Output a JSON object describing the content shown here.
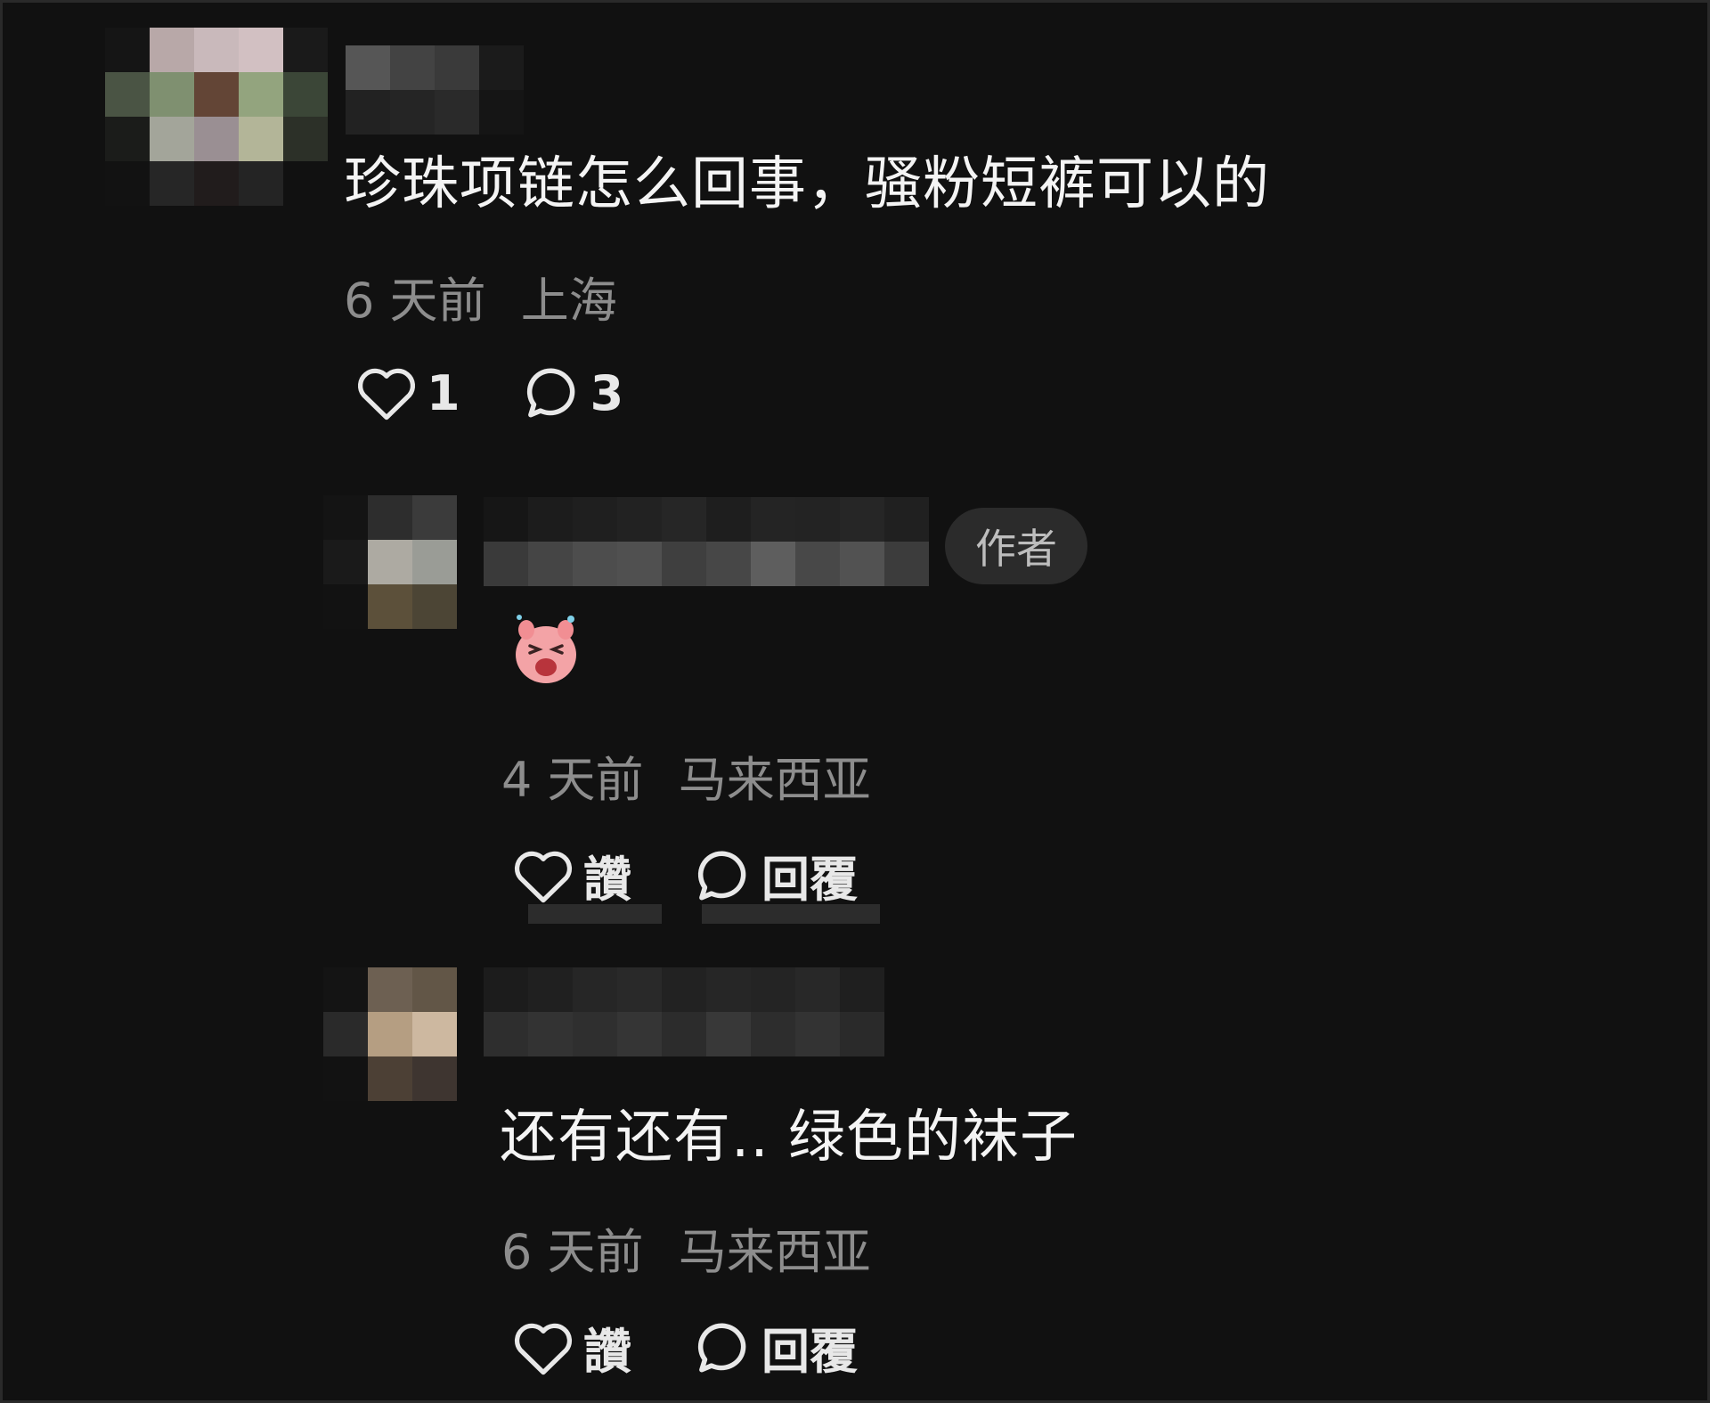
{
  "comments": [
    {
      "text": "珍珠项链怎么回事，骚粉短裤可以的",
      "time": "6 天前",
      "location": "上海",
      "likes": "1",
      "replies": "3"
    }
  ],
  "replies": [
    {
      "badge": "作者",
      "sticker": "laughing-pig-sticker",
      "time": "4 天前",
      "location": "马来西亚",
      "like_label": "讚",
      "reply_label": "回覆"
    },
    {
      "text": "还有还有.. 绿色的袜子",
      "time": "6 天前",
      "location": "马来西亚",
      "like_label": "讚",
      "reply_label": "回覆"
    }
  ],
  "colors": {
    "background": "#111111",
    "text": "#f4f4f4",
    "meta": "#8d8d8d",
    "badge_bg": "#2b2b2b"
  }
}
